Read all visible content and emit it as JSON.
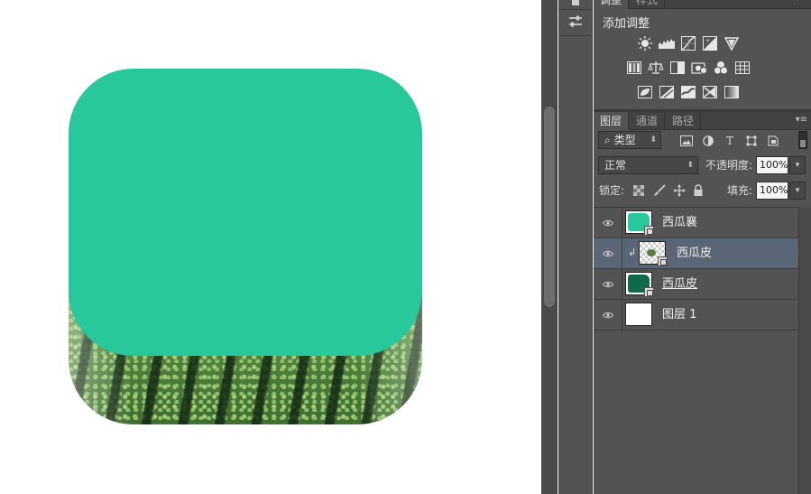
{
  "colors": {
    "melon_flesh": "#28c89c",
    "canvas_bg": "#ffffff",
    "panel_bg": "#535353",
    "selected_row": "#5a6576",
    "thumb_flesh": "#28c89c",
    "thumb_rind": "#0e6a4a"
  },
  "adjustments_panel": {
    "tabs": [
      "调整",
      "样式"
    ],
    "title": "添加调整",
    "icon_rows": [
      [
        "brightness-icon",
        "levels-icon",
        "curves-icon",
        "exposure-icon",
        "vibrance-icon"
      ],
      [
        "hue-saturation-icon",
        "color-balance-icon",
        "black-white-icon",
        "photo-filter-icon",
        "channel-mixer-icon",
        "color-lookup-icon"
      ],
      [
        "invert-icon",
        "posterize-icon",
        "threshold-icon",
        "selective-color-icon",
        "gradient-map-icon"
      ]
    ]
  },
  "layers_panel": {
    "tabs": [
      "图层",
      "通道",
      "路径"
    ],
    "filter_kind": "类型",
    "filter_icons": [
      "image-filter-icon",
      "adjustment-filter-icon",
      "type-filter-icon",
      "shape-filter-icon",
      "smart-object-filter-icon"
    ],
    "blend_mode": "正常",
    "opacity_label": "不透明度:",
    "opacity_value": "100%",
    "lock_label": "锁定:",
    "fill_label": "填充:",
    "fill_value": "100%",
    "layers": [
      {
        "name": "西瓜襄",
        "visible": true,
        "selected": false,
        "thumb": "flesh",
        "clipped": false,
        "underlined": false
      },
      {
        "name": "西瓜皮",
        "visible": true,
        "selected": true,
        "thumb": "checker",
        "clipped": true,
        "underlined": false
      },
      {
        "name": "西瓜皮",
        "visible": true,
        "selected": false,
        "thumb": "rind",
        "clipped": false,
        "underlined": true
      },
      {
        "name": "图层 1",
        "visible": true,
        "selected": false,
        "thumb": "white",
        "clipped": false,
        "underlined": false
      }
    ]
  }
}
